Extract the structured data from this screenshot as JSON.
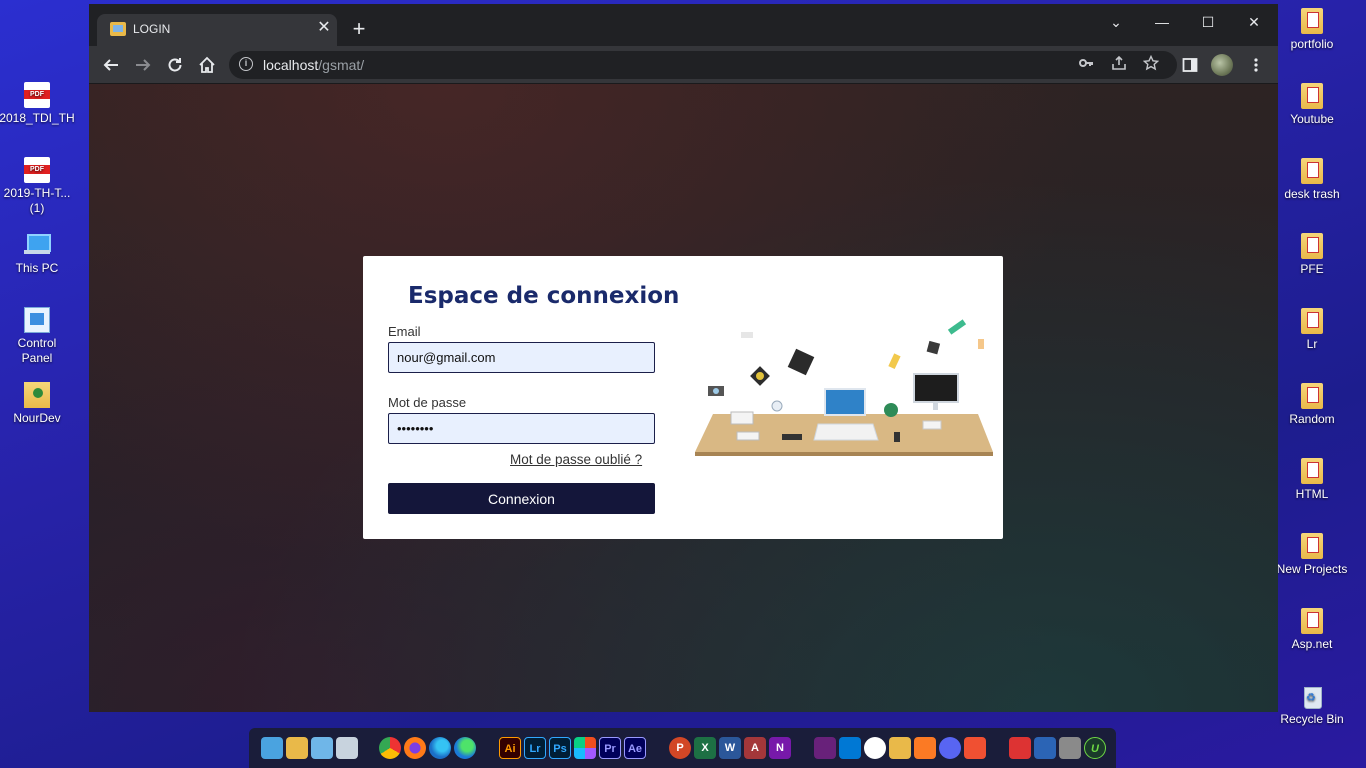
{
  "desktop": {
    "left_icons": [
      {
        "label": "2018_TDI_TH",
        "icon": "pdf-file-icon"
      },
      {
        "label": "2019-TH-T...\n(1)",
        "icon": "pdf-file-icon"
      },
      {
        "label": "This PC",
        "icon": "computer-icon"
      },
      {
        "label": "Control Panel",
        "icon": "control-panel-icon"
      },
      {
        "label": "NourDev",
        "icon": "user-folder-icon"
      }
    ],
    "right_icons": [
      {
        "label": "portfolio",
        "icon": "folder-icon"
      },
      {
        "label": "Youtube",
        "icon": "folder-icon"
      },
      {
        "label": "desk trash",
        "icon": "folder-icon"
      },
      {
        "label": "PFE",
        "icon": "folder-icon"
      },
      {
        "label": "Lr",
        "icon": "folder-icon"
      },
      {
        "label": "Random",
        "icon": "folder-icon"
      },
      {
        "label": "HTML",
        "icon": "folder-icon"
      },
      {
        "label": "New Projects",
        "icon": "folder-icon"
      },
      {
        "label": "Asp.net",
        "icon": "folder-icon"
      },
      {
        "label": "Recycle Bin",
        "icon": "recycle-bin-icon"
      }
    ]
  },
  "browser": {
    "tab_title": "LOGIN",
    "tab_close": "✕",
    "new_tab": "+",
    "url_host": "localhost",
    "url_path": "/gsmat/",
    "controls": {
      "dropdown": "⌄",
      "minimize": "—",
      "maximize": "☐",
      "close": "✕"
    }
  },
  "login": {
    "title": "Espace de connexion",
    "email_label": "Email",
    "email_value": "nour@gmail.com",
    "password_label": "Mot de passe",
    "password_value": "nourpass",
    "forgot_link": "Mot de passe oublié ?",
    "submit_label": "Connexion"
  },
  "taskbar": {
    "apps": [
      "file-explorer",
      "folder",
      "image-viewer",
      "recycle-bin",
      "chrome",
      "firefox",
      "edge",
      "edge-dev",
      "illustrator",
      "lightroom",
      "photoshop",
      "figma",
      "premiere",
      "after-effects",
      "powerpoint",
      "excel",
      "word",
      "access",
      "onenote",
      "visual-studio",
      "vscode",
      "wamp",
      "xampp-a",
      "xampp",
      "discord",
      "git",
      "ccleaner",
      "virtualbox",
      "winrar",
      "upwork"
    ],
    "labels": {
      "ai": "Ai",
      "lr": "Lr",
      "ps": "Ps",
      "pr": "Pr",
      "ae": "Ae",
      "p": "P",
      "x": "X",
      "w": "W",
      "a": "A",
      "n": "N",
      "u": "U"
    }
  },
  "colors": {
    "card_title": "#1a2a6b",
    "button_bg": "#14163a",
    "field_bg": "#e8f0fe",
    "desktop_bg": "#2722a8"
  }
}
